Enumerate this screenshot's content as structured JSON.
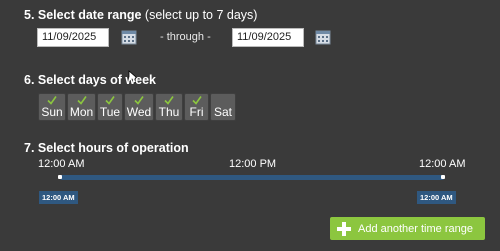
{
  "date_range": {
    "title": "5. Select date range",
    "subtitle": "(select up to 7 days)",
    "start_date": "11/09/2025",
    "through_label": "- through -",
    "end_date": "11/09/2025"
  },
  "days_of_week": {
    "title": "6. Select days of week",
    "days": [
      {
        "label": "Sun",
        "checked": true
      },
      {
        "label": "Mon",
        "checked": true
      },
      {
        "label": "Tue",
        "checked": true
      },
      {
        "label": "Wed",
        "checked": true
      },
      {
        "label": "Thu",
        "checked": true
      },
      {
        "label": "Fri",
        "checked": true
      },
      {
        "label": "Sat",
        "checked": false
      }
    ]
  },
  "hours": {
    "title": "7. Select hours of operation",
    "tick_labels": [
      "12:00 AM",
      "12:00 PM",
      "12:00 AM"
    ],
    "start_handle_label": "12:00 AM",
    "end_handle_label": "12:00 AM"
  },
  "add_range_button": {
    "label": "Add another time range",
    "icon": "plus-icon"
  },
  "colors": {
    "background": "#3a3a3a",
    "slider_track": "#2f5880",
    "add_button": "#8cc63f",
    "check": "#8cc63f"
  }
}
